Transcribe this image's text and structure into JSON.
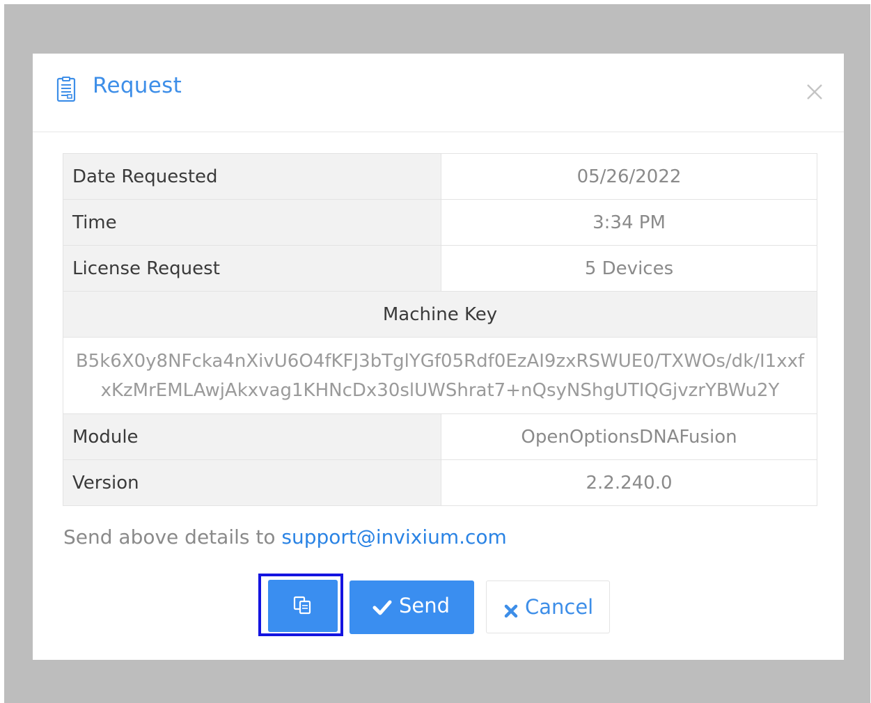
{
  "dialog": {
    "title": "Request",
    "title_icon": "document-list-icon",
    "close_icon": "close-icon"
  },
  "details": {
    "rows": [
      {
        "label": "Date Requested",
        "value": "05/26/2022"
      },
      {
        "label": "Time",
        "value": "3:34 PM"
      },
      {
        "label": "License Request",
        "value": "5 Devices"
      }
    ],
    "machine_key_header": "Machine Key",
    "machine_key_value": "B5k6X0y8NFcka4nXivU6O4fKFJ3bTglYGf05Rdf0EzAI9zxRSWUE0/TXWOs/dk/I1xxfxKzMrEMLAwjAkxvag1KHNcDx30slUWShrat7+nQsyNShgUTIQGjvzrYBWu2Y",
    "rows_after": [
      {
        "label": "Module",
        "value": "OpenOptionsDNAFusion"
      },
      {
        "label": "Version",
        "value": "2.2.240.0"
      }
    ]
  },
  "footer_note": {
    "text": "Send above details to ",
    "email": "support@invixium.com"
  },
  "buttons": {
    "copy_icon": "copy-icon",
    "send_label": "Send",
    "send_icon": "check-icon",
    "cancel_label": "Cancel",
    "cancel_icon": "times-icon"
  },
  "colors": {
    "accent": "#3a8ef0",
    "title": "#3d8ee8",
    "link": "#2a83e4",
    "focus_outline": "#1414e0",
    "backdrop": "#bdbdbd"
  }
}
